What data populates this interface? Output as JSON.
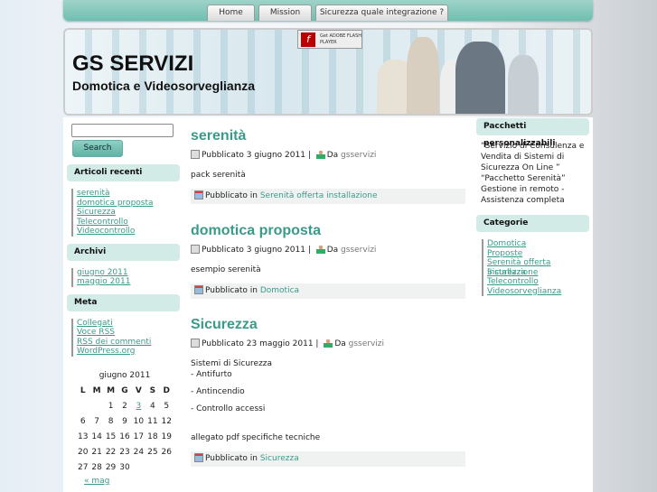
{
  "nav": {
    "tabs": [
      "Home",
      "Mission",
      "Sicurezza quale integrazione ?"
    ]
  },
  "header": {
    "title": "GS SERVIZI",
    "subtitle": "Domotica e Videosorveglianza",
    "flash_badge": "Get ADOBE FLASH PLAYER"
  },
  "search": {
    "placeholder": "",
    "value": "",
    "button": "Search"
  },
  "left": {
    "recent_title": "Articoli recenti",
    "recent": [
      "serenità",
      "domotica proposta",
      "Sicurezza",
      "Telecontrollo",
      "Videocontrollo"
    ],
    "archive_title": "Archivi",
    "archive": [
      "giugno 2011",
      "maggio 2011"
    ],
    "meta_title": "Meta",
    "meta": [
      "Collegati",
      "Voce RSS",
      "RSS dei commenti",
      "WordPress.org"
    ],
    "calendar": {
      "caption": "giugno 2011",
      "days": [
        "L",
        "M",
        "M",
        "G",
        "V",
        "S",
        "D"
      ],
      "weeks": [
        [
          "",
          "",
          "1",
          "2",
          "3",
          "4",
          "5"
        ],
        [
          "6",
          "7",
          "8",
          "9",
          "10",
          "11",
          "12"
        ],
        [
          "13",
          "14",
          "15",
          "16",
          "17",
          "18",
          "19"
        ],
        [
          "20",
          "21",
          "22",
          "23",
          "24",
          "25",
          "26"
        ],
        [
          "27",
          "28",
          "29",
          "30",
          "",
          "",
          ""
        ]
      ],
      "linked_day": "3",
      "prev": "« mag"
    }
  },
  "posts": [
    {
      "title": "serenità",
      "date": "Pubblicato 3 giugno 2011",
      "by": "Da",
      "author": "gsservizi",
      "body": [
        "pack serenità"
      ],
      "cat_label": "Pubblicato in",
      "category": "Serenità offerta installazione"
    },
    {
      "title": "domotica proposta",
      "date": "Pubblicato 3 giugno 2011",
      "by": "Da",
      "author": "gsservizi",
      "body": [
        "esempio serenità"
      ],
      "cat_label": "Pubblicato in",
      "category": "Domotica"
    },
    {
      "title": "Sicurezza",
      "date": "Pubblicato 23 maggio 2011",
      "by": "Da",
      "author": "gsservizi",
      "body": [
        "Sistemi di Sicurezza",
        "- Antifurto",
        "- Antincendio",
        "- Controllo accessi",
        "allegato pdf specifiche tecniche"
      ],
      "cat_label": "Pubblicato in",
      "category": "Sicurezza"
    }
  ],
  "right": {
    "packages_title": "Pacchetti personalizzabili",
    "packages_text": "“Servizio di Consulenza e Vendita di Sistemi di Sicurezza On Line ” “Pacchetto Serenità” Gestione in remoto - Assistenza completa",
    "categories_title": "Categorie",
    "categories": [
      "Domotica",
      "Proposte",
      "Serenità offerta installazione",
      "Sicurezza",
      "Telecontrollo",
      "Videosorveglianza"
    ]
  }
}
